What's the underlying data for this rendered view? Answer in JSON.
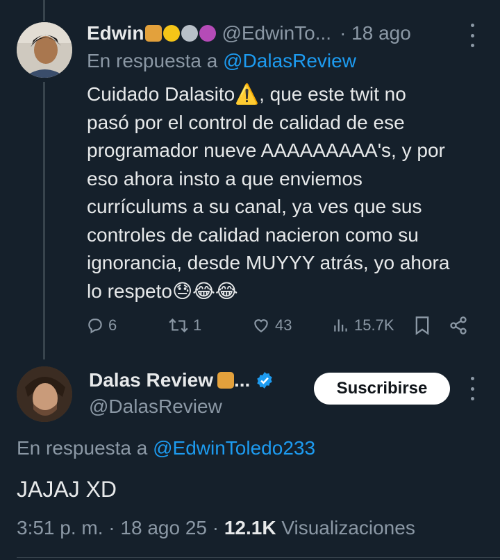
{
  "tweet1": {
    "name": "Edwin",
    "handle": "@EdwinTo...",
    "separator_time": "· 18 ago",
    "reply_prefix": "En respuesta a",
    "reply_to": "@DalasReview",
    "body_lines": [
      "Cuidado Dalasito⚠️, que este twit no",
      "pasó por el control de calidad de ese",
      "programador nueve AAAAAAAAA's, y por",
      "eso ahora insto a que enviemos",
      "currículums a su canal, ya ves que sus",
      "controles de calidad nacieron como su",
      "ignorancia, desde MUYYY atrás, yo ahora",
      "lo respeto😓😂😂"
    ],
    "actions": {
      "replies": "6",
      "reposts": "1",
      "likes": "43",
      "views": "15.7K"
    },
    "name_emojis": [
      "bread-emoji",
      "bee-emoji",
      "medal-emoji",
      "person-emoji"
    ]
  },
  "tweet2": {
    "name": "Dalas Review",
    "name_suffix": "...",
    "handle": "@DalasReview",
    "subscribe_label": "Suscribirse",
    "reply_prefix": "En respuesta a",
    "reply_to": "@EdwinToledo233",
    "body": "JAJAJ XD",
    "timestamp": "3:51 p. m. · 18 ago 25 ·",
    "views_count": "12.1K",
    "views_label": "Visualizaciones"
  },
  "colors": {
    "background": "#15202b",
    "accent": "#1d9bf0",
    "muted": "#8b98a5",
    "text": "#e7e9ea"
  }
}
